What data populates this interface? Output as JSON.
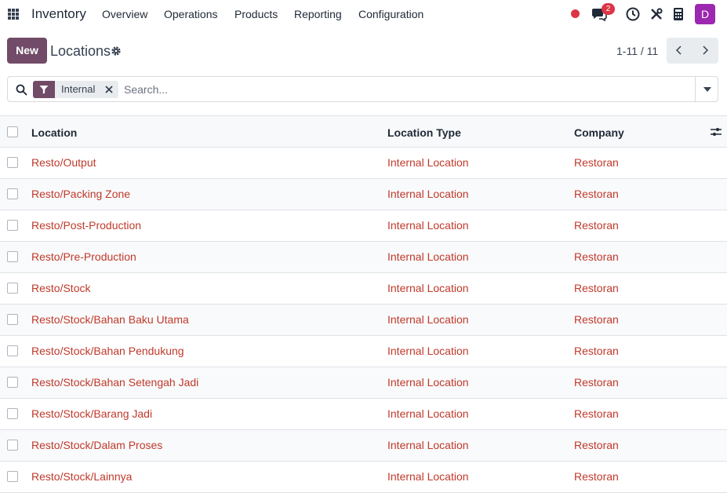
{
  "nav": {
    "app_name": "Inventory",
    "menu": [
      "Overview",
      "Operations",
      "Products",
      "Reporting",
      "Configuration"
    ],
    "chat_badge": "2",
    "avatar_letter": "D",
    "colors": {
      "accent": "#714b67",
      "avatar": "#9c27b0",
      "alert": "#dc3545"
    }
  },
  "control": {
    "new_label": "New",
    "title": "Locations",
    "pager": "1-11 / 11"
  },
  "search": {
    "facet_label": "Internal",
    "placeholder": "Search..."
  },
  "table": {
    "columns": [
      "Location",
      "Location Type",
      "Company"
    ],
    "rows": [
      {
        "location": "Resto/Output",
        "type": "Internal Location",
        "company": "Restoran"
      },
      {
        "location": "Resto/Packing Zone",
        "type": "Internal Location",
        "company": "Restoran"
      },
      {
        "location": "Resto/Post-Production",
        "type": "Internal Location",
        "company": "Restoran"
      },
      {
        "location": "Resto/Pre-Production",
        "type": "Internal Location",
        "company": "Restoran"
      },
      {
        "location": "Resto/Stock",
        "type": "Internal Location",
        "company": "Restoran"
      },
      {
        "location": "Resto/Stock/Bahan Baku Utama",
        "type": "Internal Location",
        "company": "Restoran"
      },
      {
        "location": "Resto/Stock/Bahan Pendukung",
        "type": "Internal Location",
        "company": "Restoran"
      },
      {
        "location": "Resto/Stock/Bahan Setengah Jadi",
        "type": "Internal Location",
        "company": "Restoran"
      },
      {
        "location": "Resto/Stock/Barang Jadi",
        "type": "Internal Location",
        "company": "Restoran"
      },
      {
        "location": "Resto/Stock/Dalam Proses",
        "type": "Internal Location",
        "company": "Restoran"
      },
      {
        "location": "Resto/Stock/Lainnya",
        "type": "Internal Location",
        "company": "Restoran"
      }
    ]
  }
}
